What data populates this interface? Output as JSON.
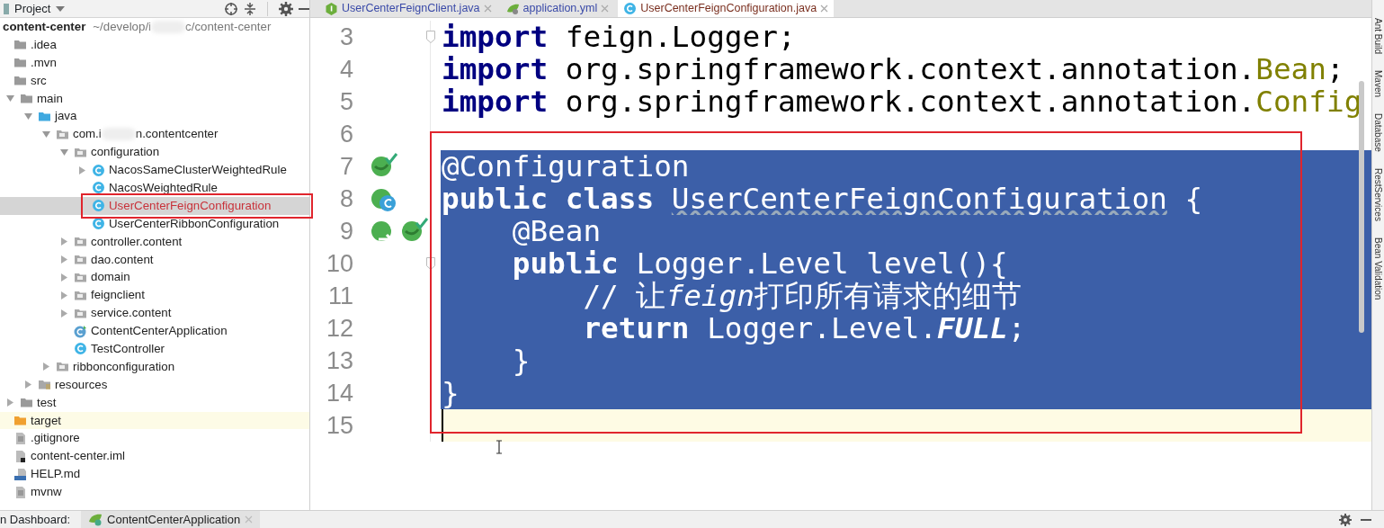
{
  "sidebar": {
    "title": "Project",
    "root": {
      "name": "content-center",
      "path_start": "~/develop/i",
      "path_end": "c/content-center"
    },
    "items": [
      {
        "label": ".idea",
        "kind": "folder",
        "selected": false
      },
      {
        "label": ".mvn",
        "kind": "folder",
        "selected": false
      },
      {
        "label": "src",
        "kind": "folder",
        "selected": false,
        "children": [
          {
            "label": "main",
            "kind": "folder",
            "expanded": true,
            "selected": false,
            "children": [
              {
                "label": "java",
                "kind": "source",
                "expanded": true,
                "selected": false,
                "children": [
                  {
                    "label_start": "com.i",
                    "label": "n.contentcenter",
                    "kind": "package",
                    "expanded": true,
                    "selected": false,
                    "children": [
                      {
                        "label": "configuration",
                        "kind": "package",
                        "expanded": true,
                        "selected": false,
                        "children": [
                          {
                            "label": "NacosSameClusterWeightedRule",
                            "kind": "class",
                            "expanded": false,
                            "selected": false
                          },
                          {
                            "label": "NacosWeightedRule",
                            "kind": "class",
                            "selected": false
                          },
                          {
                            "label": "UserCenterFeignConfiguration",
                            "kind": "class",
                            "selected": true,
                            "color": "#c8323a",
                            "boxed": true
                          },
                          {
                            "label": "UserCenterRibbonConfiguration",
                            "kind": "class",
                            "selected": false
                          }
                        ]
                      },
                      {
                        "label": "controller.content",
                        "kind": "package",
                        "expanded": false,
                        "selected": false
                      },
                      {
                        "label": "dao.content",
                        "kind": "package",
                        "expanded": false,
                        "selected": false
                      },
                      {
                        "label": "domain",
                        "kind": "package",
                        "expanded": false,
                        "selected": false
                      },
                      {
                        "label": "feignclient",
                        "kind": "package",
                        "expanded": false,
                        "selected": false
                      },
                      {
                        "label": "service.content",
                        "kind": "package",
                        "expanded": false,
                        "selected": false
                      },
                      {
                        "label": "ContentCenterApplication",
                        "kind": "app",
                        "selected": false
                      },
                      {
                        "label": "TestController",
                        "kind": "class",
                        "selected": false
                      }
                    ]
                  },
                  {
                    "label": "ribbonconfiguration",
                    "kind": "package",
                    "expanded": false,
                    "selected": false
                  }
                ]
              },
              {
                "label": "resources",
                "kind": "resources",
                "expanded": false,
                "selected": false
              }
            ]
          },
          {
            "label": "test",
            "kind": "folder",
            "expanded": false,
            "selected": false
          }
        ]
      },
      {
        "label": "target",
        "kind": "excluded",
        "selected": false,
        "highlighted": true
      },
      {
        "label": ".gitignore",
        "kind": "file",
        "selected": false
      },
      {
        "label": "content-center.iml",
        "kind": "iml",
        "selected": false
      },
      {
        "label": "HELP.md",
        "kind": "md",
        "selected": false
      },
      {
        "label": "mvnw",
        "kind": "file",
        "selected": false
      }
    ]
  },
  "tabs": [
    {
      "label": "UserCenterFeignClient.java",
      "kind": "interface",
      "selected": false
    },
    {
      "label": "application.yml",
      "kind": "yml",
      "selected": false
    },
    {
      "label": "UserCenterFeignConfiguration.java",
      "kind": "class",
      "selected": true
    }
  ],
  "editor": {
    "boxed": true,
    "lines": [
      {
        "number": "3",
        "selected": false,
        "current": false,
        "fold": true,
        "tokens": [
          {
            "kind": "kw",
            "text": "import"
          },
          {
            "kind": "plain",
            "text": " feign.Logger;"
          }
        ]
      },
      {
        "number": "4",
        "selected": false,
        "current": false,
        "tokens": [
          {
            "kind": "kw",
            "text": "import"
          },
          {
            "kind": "plain",
            "text": " org.springframework.context.annotation."
          },
          {
            "kind": "type",
            "text": "Bean"
          },
          {
            "kind": "plain",
            "text": ";"
          }
        ]
      },
      {
        "number": "5",
        "selected": false,
        "current": false,
        "tokens": [
          {
            "kind": "kw",
            "text": "import"
          },
          {
            "kind": "plain",
            "text": " org.springframework.context.annotation."
          },
          {
            "kind": "type",
            "text": "Config"
          }
        ]
      },
      {
        "number": "6",
        "selected": false,
        "current": false
      },
      {
        "number": "7",
        "selected": true,
        "current": false,
        "gutter": [
          {
            "kind": "bean"
          }
        ],
        "tokens": [
          {
            "kind": "plain",
            "text": "@Configuration"
          }
        ]
      },
      {
        "number": "8",
        "selected": true,
        "current": false,
        "gutter": [
          {
            "kind": "spring-class"
          }
        ],
        "tokens": [
          {
            "kind": "kw",
            "text": "public class "
          },
          {
            "kind": "warn",
            "text": "UserCenterFeignConfiguration"
          },
          {
            "kind": "plain",
            "text": " {"
          }
        ]
      },
      {
        "number": "9",
        "selected": true,
        "current": false,
        "gutter": [
          {
            "kind": "spring-method"
          },
          {
            "kind": "bean"
          }
        ],
        "tokens": [
          {
            "kind": "plain",
            "text": "    @Bean"
          }
        ]
      },
      {
        "number": "10",
        "selected": true,
        "current": false,
        "fold": true,
        "tokens": [
          {
            "kind": "kw",
            "text": "    public"
          },
          {
            "kind": "plain",
            "text": " Logger.Level level(){"
          }
        ]
      },
      {
        "number": "11",
        "selected": true,
        "current": false,
        "tokens": [
          {
            "kind": "plain",
            "text": "        // 让"
          },
          {
            "kind": "italic",
            "text": "feign"
          },
          {
            "kind": "plain",
            "text": "打印所有请求的细节"
          }
        ]
      },
      {
        "number": "12",
        "selected": true,
        "current": false,
        "tokens": [
          {
            "kind": "kw",
            "text": "        return"
          },
          {
            "kind": "plain",
            "text": " Logger.Level."
          },
          {
            "kind": "static",
            "text": "FULL"
          },
          {
            "kind": "plain",
            "text": ";"
          }
        ]
      },
      {
        "number": "13",
        "selected": true,
        "current": false,
        "tokens": [
          {
            "kind": "plain",
            "text": "    }"
          }
        ]
      },
      {
        "number": "14",
        "selected": true,
        "current": false,
        "tokens": [
          {
            "kind": "plain",
            "text": "}"
          }
        ]
      },
      {
        "number": "15",
        "selected": false,
        "current": true
      }
    ]
  },
  "tool_strip": [
    "Ant Build",
    "Maven",
    "Database",
    "RestServices",
    "Bean Validation"
  ],
  "bottom_bar": {
    "label": "n Dashboard:",
    "tab": "ContentCenterApplication"
  }
}
